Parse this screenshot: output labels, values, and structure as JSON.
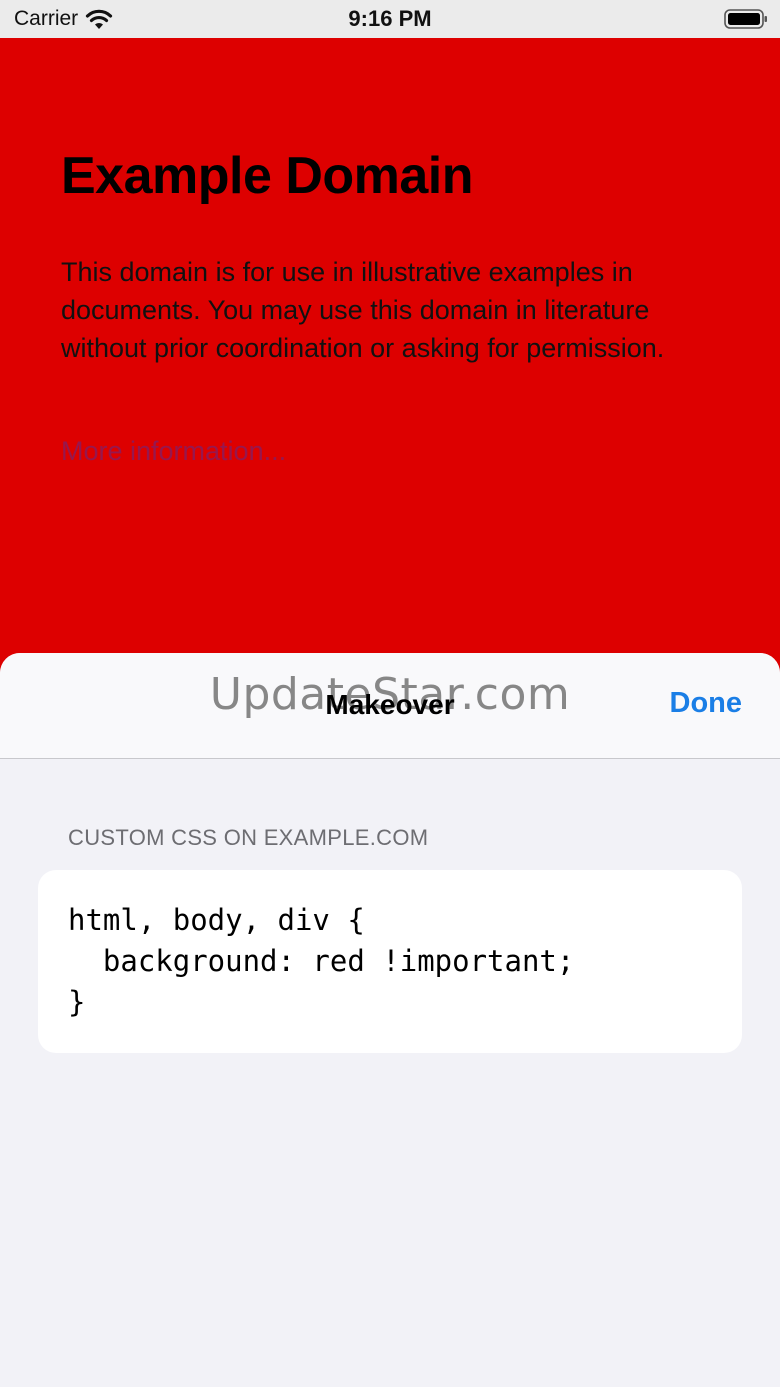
{
  "status_bar": {
    "carrier": "Carrier",
    "time": "9:16 PM",
    "icons": [
      "wifi-icon",
      "battery-icon"
    ]
  },
  "web_page": {
    "title": "Example Domain",
    "body": "This domain is for use in illustrative examples in documents. You may use this domain in literature without prior coordination or asking for permission.",
    "link": "More information..."
  },
  "sheet": {
    "watermark": "UpdateStar.com",
    "title": "Makeover",
    "done_label": "Done",
    "section_label": "CUSTOM CSS ON EXAMPLE.COM",
    "code_lines": [
      "html, body, div {",
      "  background: red !important;",
      "}"
    ]
  },
  "colors": {
    "page_background": "#dd0000",
    "accent": "#1a7ee6",
    "sheet_background": "#f2f2f7"
  }
}
